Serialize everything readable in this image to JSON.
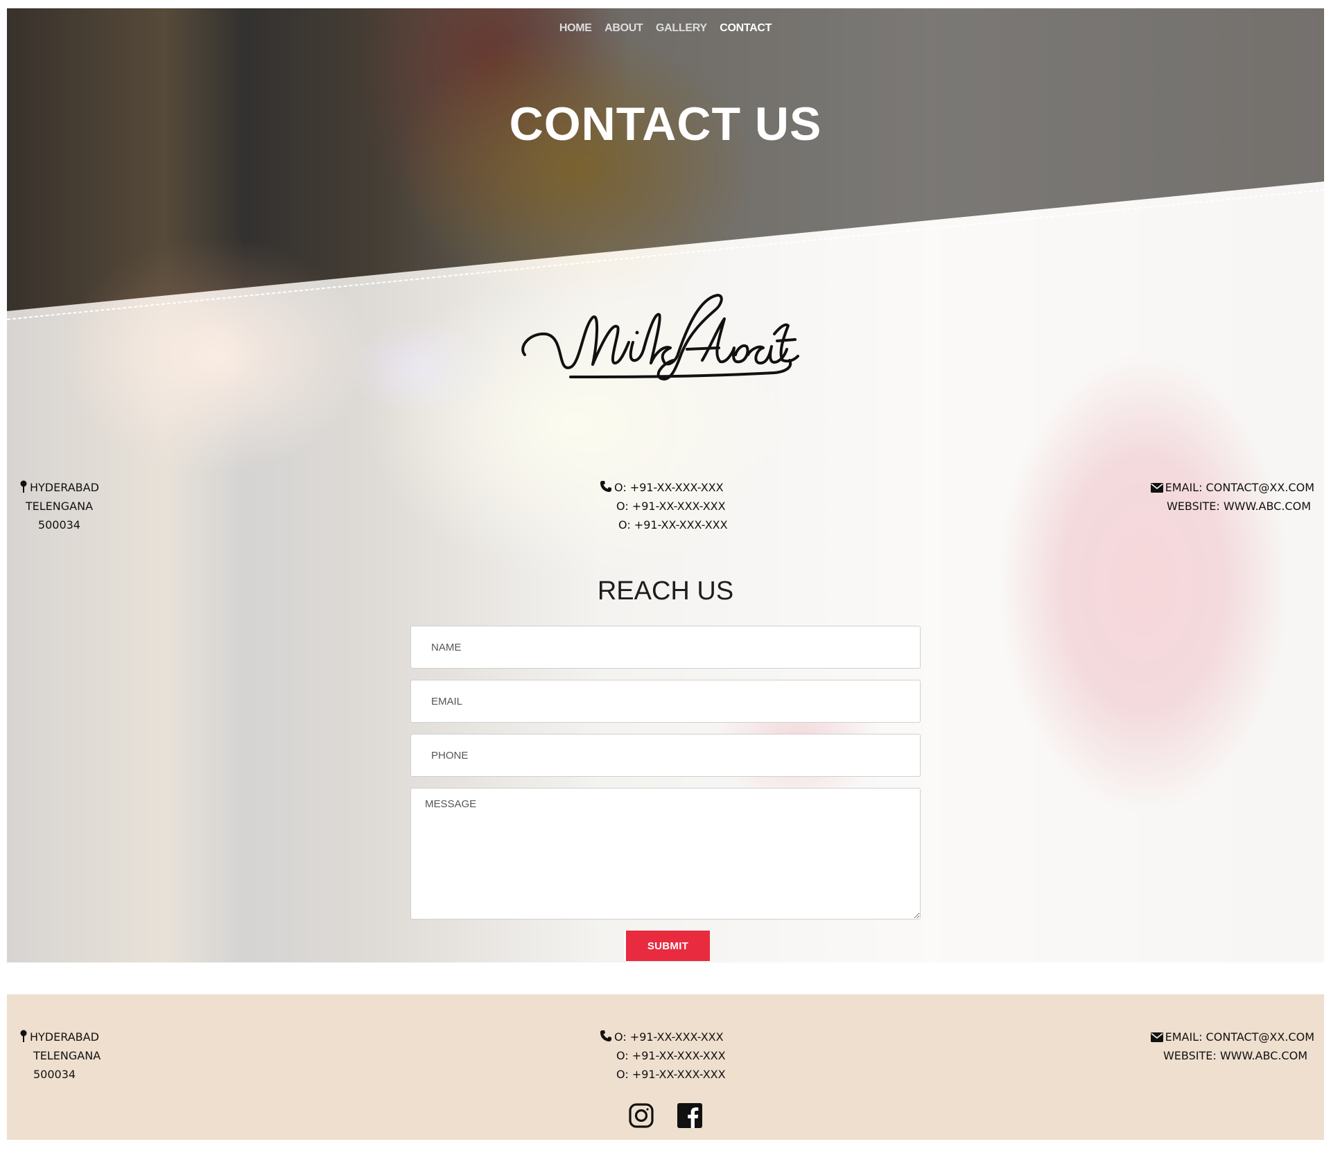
{
  "nav": {
    "items": [
      {
        "label": "HOME"
      },
      {
        "label": "ABOUT"
      },
      {
        "label": "GALLERY"
      },
      {
        "label": "CONTACT",
        "active": true
      }
    ]
  },
  "hero": {
    "title": "CONTACT US"
  },
  "brand": {
    "logo_text": "Milkfloat"
  },
  "contact": {
    "address": [
      "HYDERABAD",
      "TELENGANA",
      "500034"
    ],
    "phones": [
      "O: +91-XX-XXX-XXX",
      "O: +91-XX-XXX-XXX",
      "O: +91-XX-XXX-XXX"
    ],
    "email": "EMAIL: CONTACT@XX.COM",
    "website": "WEBSITE: WWW.ABC.COM"
  },
  "form": {
    "title": "REACH US",
    "name_placeholder": "NAME",
    "email_placeholder": "EMAIL",
    "phone_placeholder": "PHONE",
    "message_placeholder": "MESSAGE",
    "submit_label": "SUBMIT"
  },
  "footer": {
    "address": [
      "HYDERABAD",
      "TELENGANA",
      "500034"
    ],
    "phones": [
      "O: +91-XX-XXX-XXX",
      "O: +91-XX-XXX-XXX",
      "O: +91-XX-XXX-XXX"
    ],
    "email": "EMAIL: CONTACT@XX.COM",
    "website": "WEBSITE: WWW.ABC.COM",
    "social_icons": [
      "instagram-icon",
      "facebook-icon"
    ]
  },
  "colors": {
    "accent": "#e82b3e",
    "footer_bg": "#efdfce",
    "hero_overlay": "#373737"
  }
}
